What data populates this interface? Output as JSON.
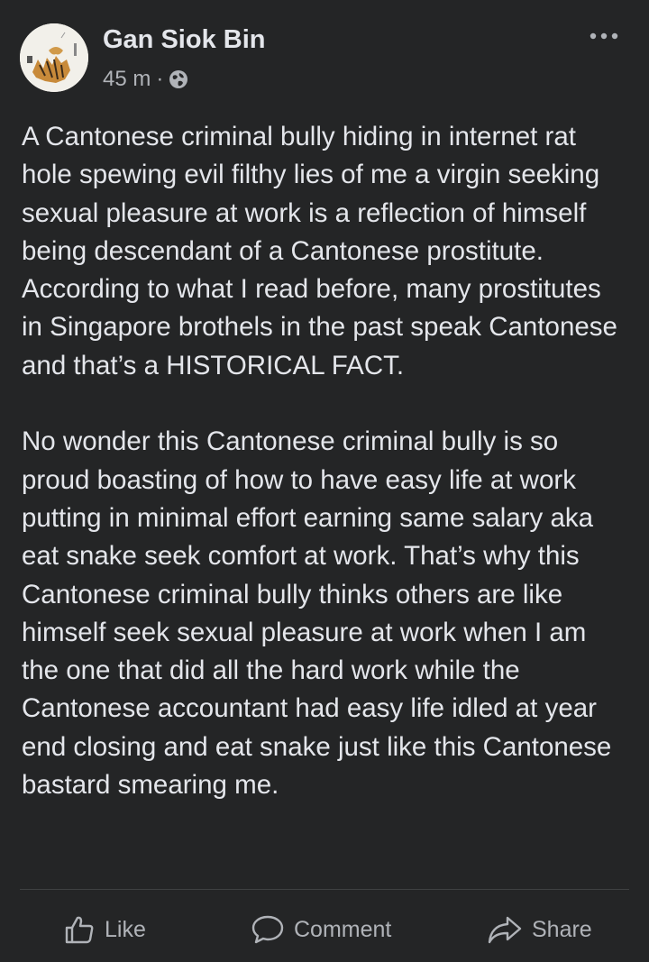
{
  "post": {
    "author": "Gan Siok Bin",
    "time": "45 m",
    "separator": "·",
    "privacy_icon": "globe-icon",
    "more_icon": "more-options-icon",
    "body": "A Cantonese criminal bully hiding in internet rat hole spewing evil filthy lies of me a virgin seeking sexual pleasure at work is a reflection of himself being descendant of a Cantonese prostitute. According to what I read before, many prostitutes in Singapore brothels in the past speak Cantonese and that’s a HISTORICAL FACT.\n\nNo wonder this Cantonese criminal bully is so proud boasting of how to have easy life at work putting in minimal effort earning same salary aka eat snake seek comfort at work. That’s why this Cantonese criminal bully thinks others are like himself seek sexual pleasure at work when I am the one that did all the hard work while the Cantonese accountant had easy life idled at year end closing and eat snake just like this Cantonese bastard smearing me."
  },
  "actions": {
    "like_label": "Like",
    "comment_label": "Comment",
    "share_label": "Share"
  },
  "colors": {
    "background": "#242526",
    "primary_text": "#e4e6eb",
    "secondary_text": "#b0b3b8",
    "divider": "#3e4042"
  }
}
